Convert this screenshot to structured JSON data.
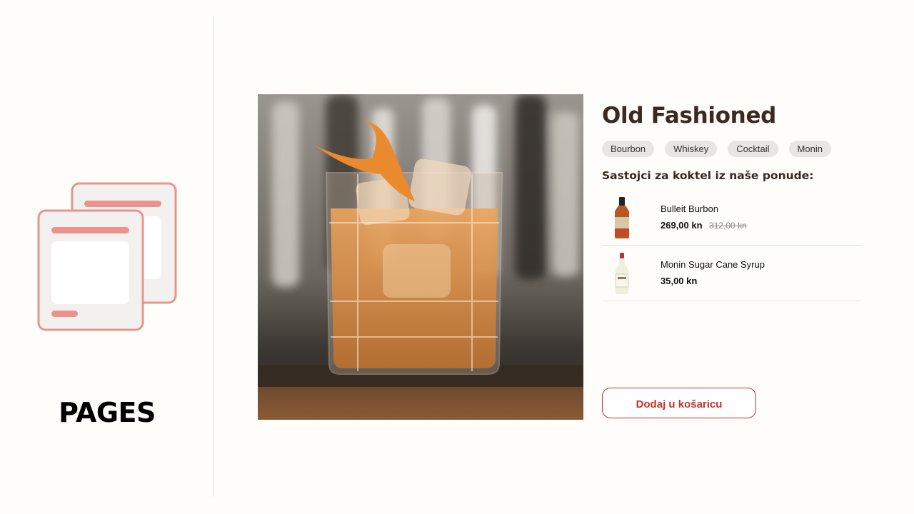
{
  "sidebar": {
    "label": "PAGES",
    "icon": "pages-icon"
  },
  "product": {
    "title": "Old Fashioned",
    "image": "old-fashioned-cocktail-photo",
    "tags": [
      "Bourbon",
      "Whiskey",
      "Cocktail",
      "Monin"
    ],
    "ingredients_heading": "Sastojci za koktel iz naše ponude:",
    "ingredients": [
      {
        "name": "Bulleit Burbon",
        "price": "269,00 kn",
        "old_price": "312,00 kn",
        "thumb": "bourbon-bottle-icon"
      },
      {
        "name": "Monin Sugar Cane Syrup",
        "price": "35,00 kn",
        "thumb": "syrup-bottle-icon"
      }
    ],
    "cart_button": "Dodaj u košaricu"
  },
  "colors": {
    "background": "#fefdfa",
    "accent": "#c7322b",
    "title": "#3a2a22",
    "tag_bg": "#e7e6e3",
    "illustration_stroke": "#e5958e"
  }
}
